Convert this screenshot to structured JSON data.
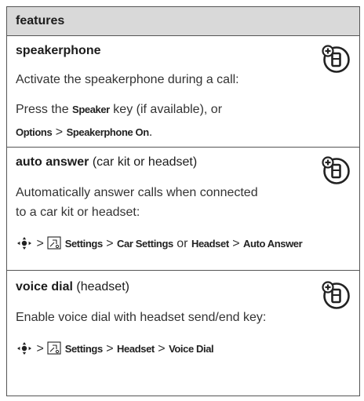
{
  "header": {
    "title": "features"
  },
  "speakerphone": {
    "title": "speakerphone",
    "desc": "Activate the speakerphone during a call:",
    "press": "Press the",
    "speaker_key": "Speaker",
    "key_suffix": "key (if available), or",
    "options": "Options",
    "gt": ">",
    "speakerphone_on": "Speakerphone On",
    "period": "."
  },
  "auto_answer": {
    "title": "auto answer",
    "qualifier": "(car kit or headset)",
    "desc_line1": "Automatically answer calls when connected",
    "desc_line2": "to a car kit or headset:",
    "gt": ">",
    "settings": "Settings",
    "car_settings": "Car Settings",
    "or": "or",
    "headset": "Headset",
    "auto_answer_item": "Auto Answer"
  },
  "voice_dial": {
    "title": "voice dial",
    "qualifier": "(headset)",
    "desc": "Enable voice dial with headset send/end key:",
    "gt": ">",
    "settings": "Settings",
    "headset": "Headset",
    "voice_dial_item": "Voice Dial"
  },
  "icons": {
    "network_feature": "network-feature-icon",
    "nav_key": "navigation-key-icon",
    "menu": "menu-settings-icon"
  }
}
